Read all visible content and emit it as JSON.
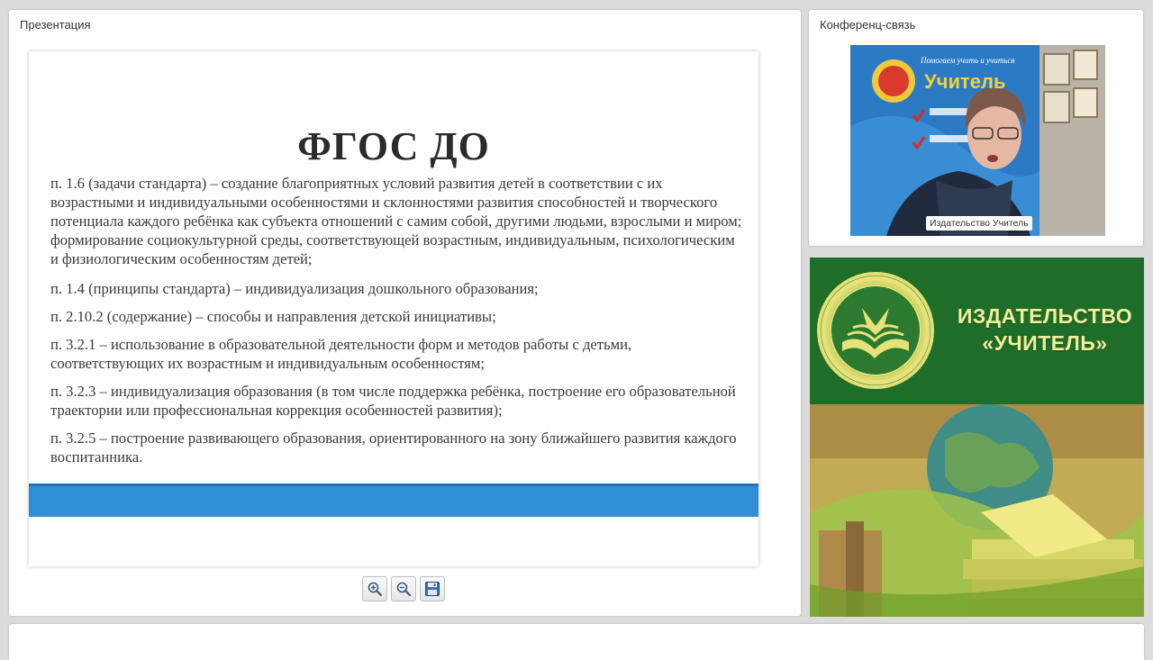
{
  "presentation": {
    "title": "Презентация",
    "slide": {
      "title": "ФГОС ДО",
      "paragraphs": [
        "п. 1.6 (задачи стандарта) – создание благоприятных условий развития детей в соответствии с их возрастными и индивидуальными особенностями и склонностями развития способностей и творческого потенциала каждого ребёнка как субъекта отношений с самим собой, другими людьми, взрослыми и миром; формирование социокультурной среды, соответствующей возрастным, индивидуальным, психологическим и физиологическим особенностям детей;",
        "п. 1.4 (принципы стандарта) – индивидуализация дошкольного образования;",
        "п. 2.10.2 (содержание) – способы и направления детской инициативы;",
        "п. 3.2.1 – использование в образовательной деятельности форм и методов работы с детьми, соответствующих их возрастным и индивидуальным особенностям;",
        "п. 3.2.3 – индивидуализация образования (в том числе поддержка ребёнка, построение его образовательной траектории или профессиональная коррекция особенностей развития);",
        "п. 3.2.5 – построение развивающего образования, ориентированного на зону ближайшего развития каждого воспитанника."
      ]
    },
    "toolbar": {
      "zoom_in_icon": "zoom-in-icon",
      "zoom_out_icon": "zoom-out-icon",
      "save_icon": "save-icon"
    }
  },
  "conference": {
    "title": "Конференц-связь",
    "video_caption": "Издательство Учитель",
    "backdrop_lines": [
      "Помогаем учить и учиться",
      "Учитель"
    ]
  },
  "publisher": {
    "name_line1": "ИЗДАТЕЛЬСТВО",
    "name_line2": "«УЧИТЕЛЬ»"
  },
  "colors": {
    "slide_bar": "#2f8fd6",
    "publisher_green": "#1e6e2a",
    "publisher_text": "#f2ee9a"
  }
}
